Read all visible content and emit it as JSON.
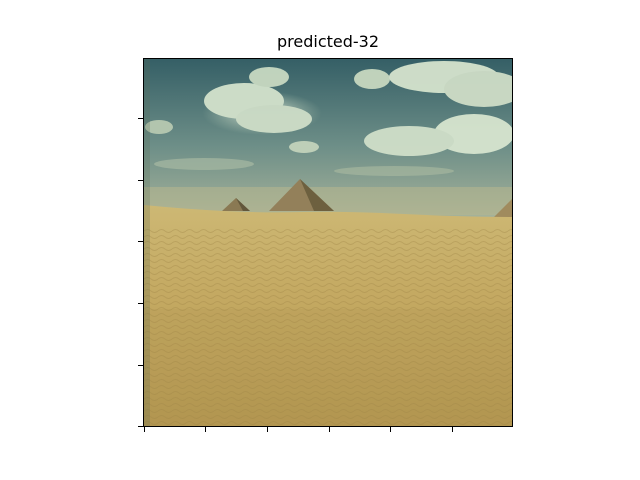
{
  "title": "predicted-32",
  "image": {
    "subject": "desert-with-pyramids",
    "colors": {
      "sky_top": "#3d6a6e",
      "sky_bottom": "#8fa79a",
      "cloud": "#d9e8d3",
      "sand_far": "#c9b26c",
      "sand_near": "#b89c55",
      "pyramid": "#8c7a52",
      "pyramid_shadow": "#5e533b"
    }
  },
  "axes": {
    "x_ticks": 6,
    "y_ticks": 6,
    "tick_labels_visible": false
  }
}
